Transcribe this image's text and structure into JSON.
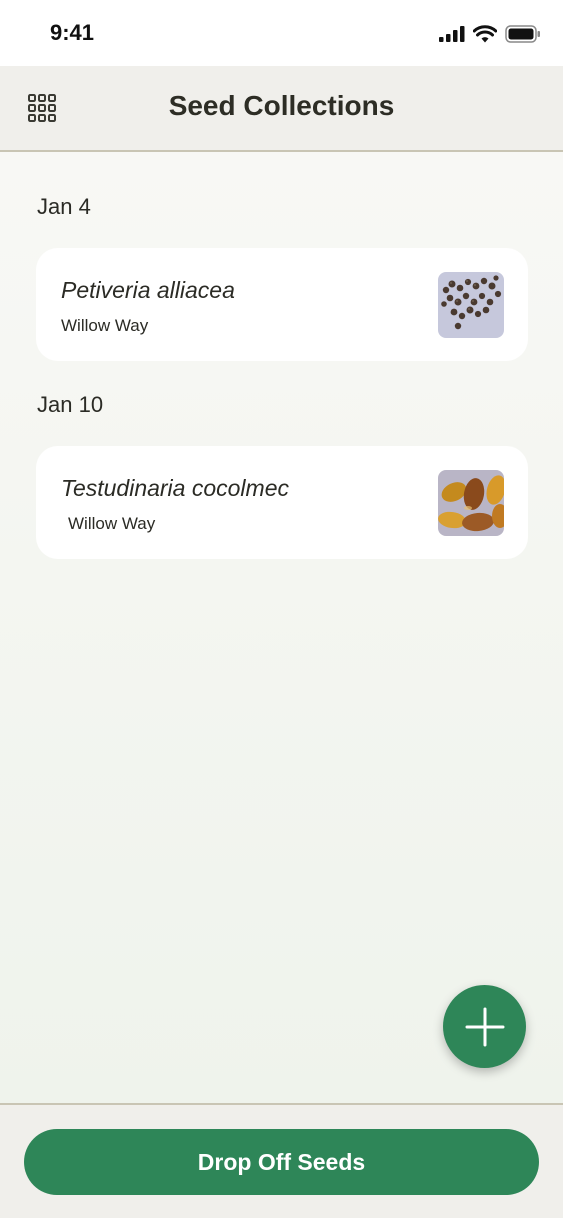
{
  "status_bar": {
    "time": "9:41",
    "icons": [
      "cellular-signal-icon",
      "wifi-icon",
      "battery-icon"
    ]
  },
  "header": {
    "title": "Seed Collections",
    "menu_icon": "grid-menu-icon"
  },
  "groups": [
    {
      "date": "Jan 4",
      "items": [
        {
          "species": "Petiveria alliacea",
          "location": "Willow Way",
          "thumbnail": "seed-photo"
        }
      ]
    },
    {
      "date": "Jan 10",
      "items": [
        {
          "species": "Testudinaria cocolmec",
          "location": "Willow Way",
          "thumbnail": "seed-photo"
        }
      ]
    }
  ],
  "fab": {
    "icon": "plus-icon"
  },
  "footer": {
    "primary_action": "Drop Off Seeds"
  },
  "colors": {
    "accent": "#2e8658",
    "header_bg": "#f0efeb",
    "divider": "#c9c5b4",
    "text": "#2b2b25"
  }
}
